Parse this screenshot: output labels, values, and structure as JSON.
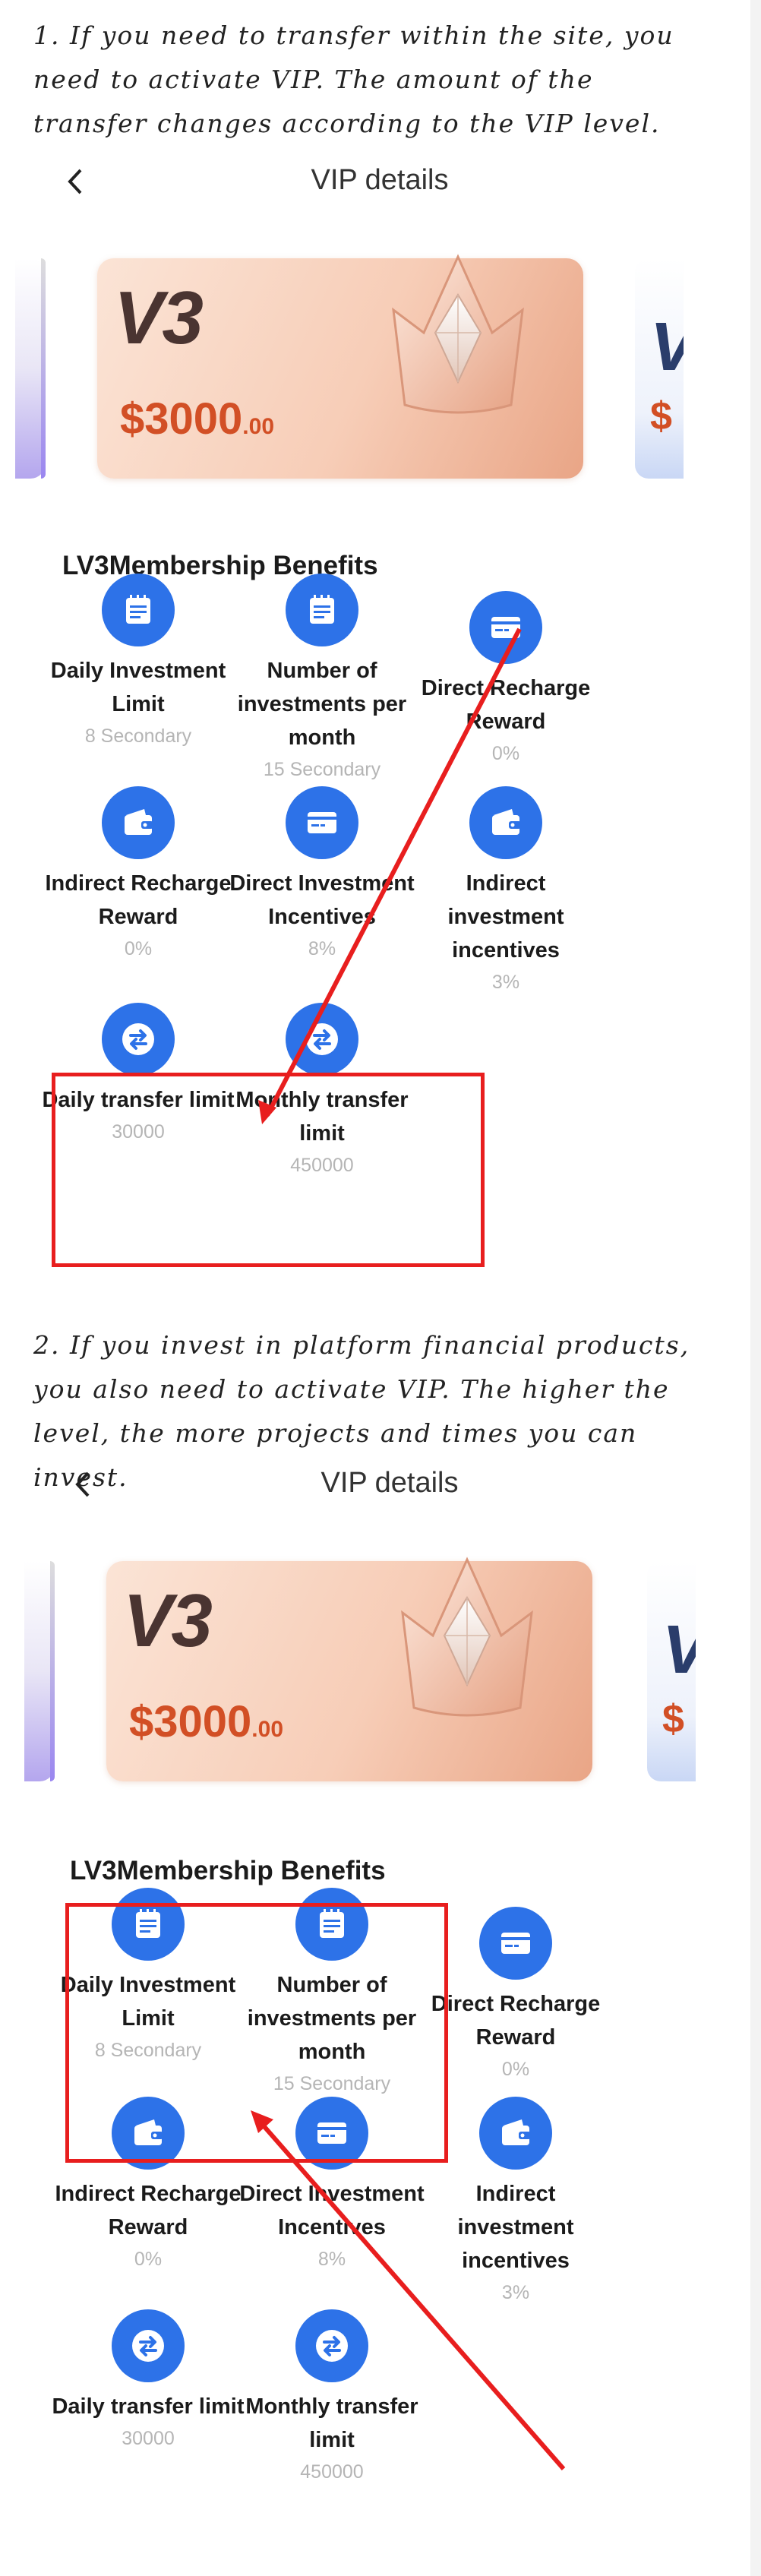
{
  "instructions": {
    "first": "1. If you need to transfer within the site, you need to activate VIP. The amount of the transfer changes according to the VIP level.",
    "second": "2. If you invest in platform financial products, you also need to activate VIP. The higher the level, the more projects and times you can invest."
  },
  "screens": [
    {
      "header": {
        "back_icon": "chevron-left-icon",
        "title": "VIP details"
      },
      "card": {
        "level": "V3",
        "price": "$3000",
        "cents": ".00",
        "next_level_letter": "V",
        "next_price": "$"
      },
      "benefits_title": "LV3Membership Benefits",
      "benefits": [
        {
          "icon": "calendar-icon",
          "label": "Daily Investment Limit",
          "value": "8 Secondary"
        },
        {
          "icon": "calendar-icon",
          "label": "Number of investments per month",
          "value": "15 Secondary"
        },
        {
          "icon": "card-icon",
          "label": "Direct Recharge Reward",
          "value": "0%"
        },
        {
          "icon": "wallet-icon",
          "label": "Indirect Recharge Reward",
          "value": "0%"
        },
        {
          "icon": "card-icon",
          "label": "Direct Investment Incentives",
          "value": "8%"
        },
        {
          "icon": "wallet-icon",
          "label": "Indirect investment incentives",
          "value": "3%"
        },
        {
          "icon": "transfer-icon",
          "label": "Daily transfer limit",
          "value": "30000"
        },
        {
          "icon": "transfer-icon",
          "label": "Monthly transfer limit",
          "value": "450000"
        }
      ]
    },
    {
      "header": {
        "back_icon": "chevron-left-icon",
        "title": "VIP details"
      },
      "card": {
        "level": "V3",
        "price": "$3000",
        "cents": ".00",
        "next_level_letter": "V",
        "next_price": "$"
      },
      "benefits_title": "LV3Membership Benefits",
      "benefits": [
        {
          "icon": "calendar-icon",
          "label": "Daily Investment Limit",
          "value": "8 Secondary"
        },
        {
          "icon": "calendar-icon",
          "label": "Number of investments per month",
          "value": "15 Secondary"
        },
        {
          "icon": "card-icon",
          "label": "Direct Recharge Reward",
          "value": "0%"
        },
        {
          "icon": "wallet-icon",
          "label": "Indirect Recharge Reward",
          "value": "0%"
        },
        {
          "icon": "card-icon",
          "label": "Direct Investment Incentives",
          "value": "8%"
        },
        {
          "icon": "wallet-icon",
          "label": "Indirect investment incentives",
          "value": "3%"
        },
        {
          "icon": "transfer-icon",
          "label": "Daily transfer limit",
          "value": "30000"
        },
        {
          "icon": "transfer-icon",
          "label": "Monthly transfer limit",
          "value": "450000"
        }
      ]
    }
  ],
  "colors": {
    "accent_blue": "#2d72e8",
    "price_red": "#d24f25",
    "annotation_red": "#e81e1e"
  }
}
